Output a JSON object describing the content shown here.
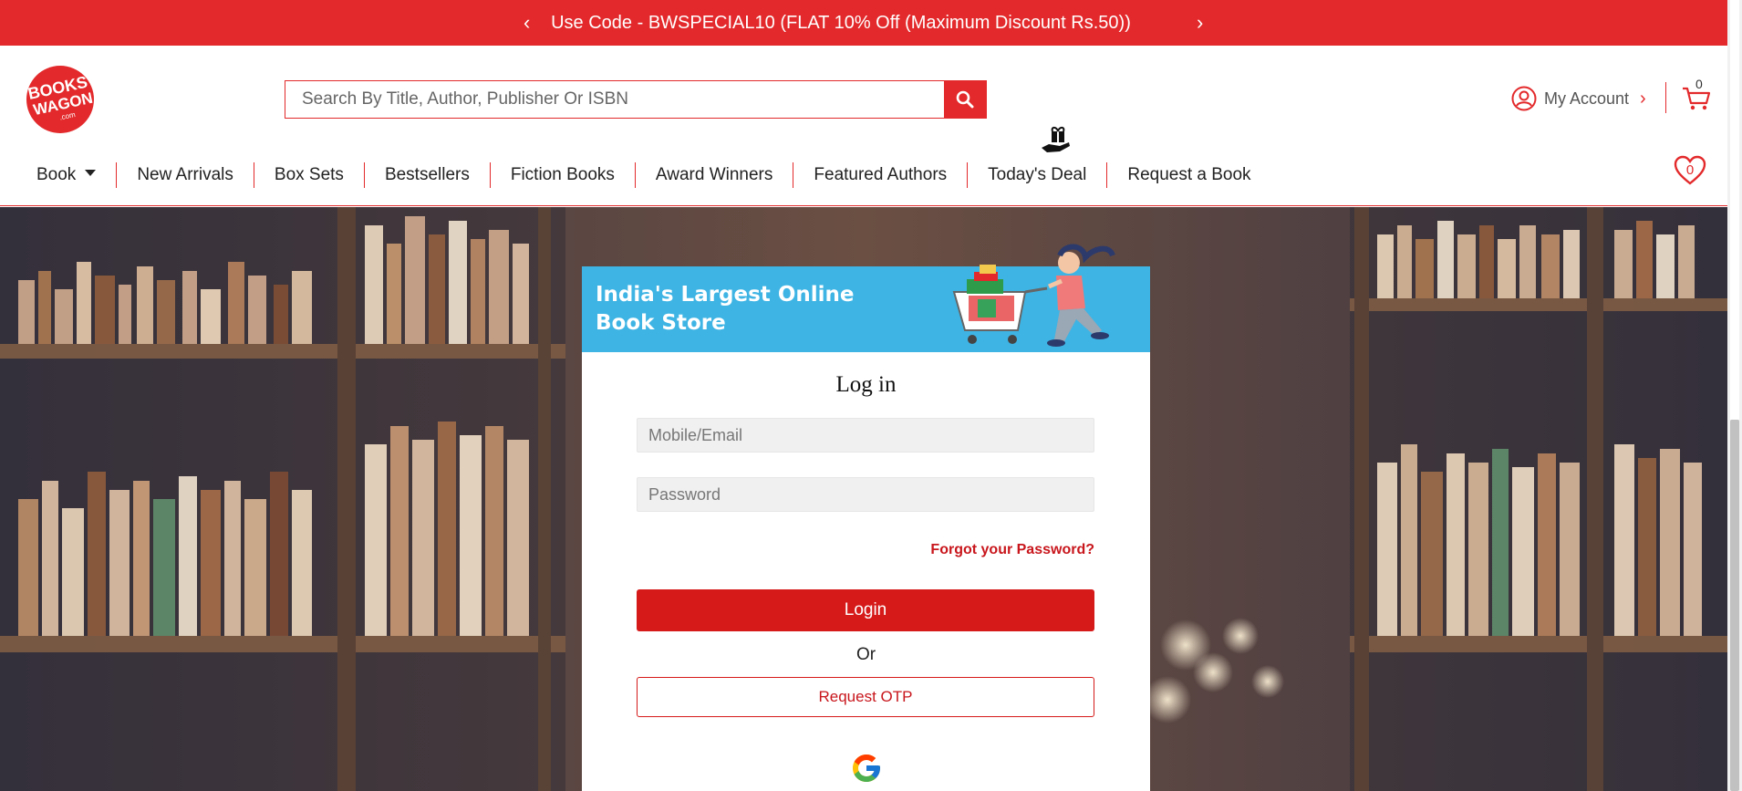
{
  "promo": {
    "text": "Use Code - BWSPECIAL10 (FLAT 10% Off (Maximum Discount Rs.50))",
    "prev": "‹",
    "next": "›"
  },
  "header": {
    "logo_text": [
      "BOOKS",
      "WAGON",
      ".com"
    ],
    "search_placeholder": "Search By Title, Author, Publisher Or ISBN",
    "account_label": "My Account",
    "account_chevron": "›",
    "cart_count": "0",
    "wishlist_count": "0"
  },
  "nav": {
    "items": [
      "Book",
      "New Arrivals",
      "Box Sets",
      "Bestsellers",
      "Fiction Books",
      "Award Winners",
      "Featured Authors",
      "Today's Deal",
      "Request a Book"
    ]
  },
  "login": {
    "banner_line1": "India's Largest Online",
    "banner_line2": "Book Store",
    "title": "Log in",
    "mobile_placeholder": "Mobile/Email",
    "password_placeholder": "Password",
    "forgot": "Forgot your Password?",
    "login_label": "Login",
    "or_label": "Or",
    "otp_label": "Request OTP"
  },
  "colors": {
    "brand_red": "#e3292b",
    "banner_blue": "#3eb4e4"
  },
  "icons": [
    "chevron-left-icon",
    "chevron-right-icon",
    "search-icon",
    "user-icon",
    "cart-icon",
    "heart-icon",
    "gift-hand-icon",
    "google-icon"
  ]
}
